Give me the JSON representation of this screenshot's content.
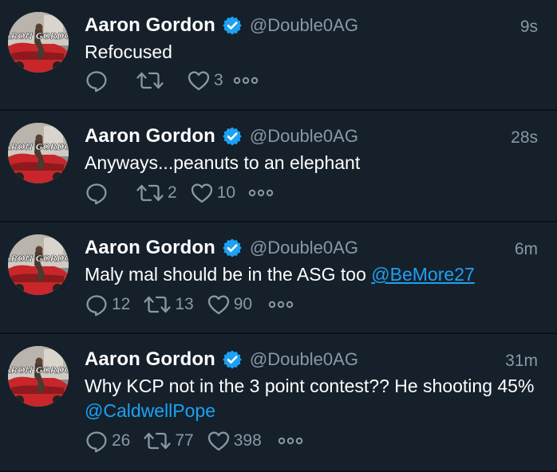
{
  "colors": {
    "background": "#15202b",
    "separator": "#0b1016",
    "text": "#ffffff",
    "muted": "#8899a6",
    "link": "#1da1f2",
    "verified": "#1da1f2"
  },
  "tweets": [
    {
      "name": "Aaron Gordon",
      "handle": "@Double0AG",
      "time": "9s",
      "text": "Refocused",
      "mention": "",
      "reply_count": "",
      "retweet_count": "",
      "like_count": "3"
    },
    {
      "name": "Aaron Gordon",
      "handle": "@Double0AG",
      "time": "28s",
      "text": "Anyways...peanuts to an elephant",
      "mention": "",
      "reply_count": "",
      "retweet_count": "2",
      "like_count": "10"
    },
    {
      "name": "Aaron Gordon",
      "handle": "@Double0AG",
      "time": "6m",
      "text": "Maly mal should be in the ASG too ",
      "mention": "@BeMore27",
      "reply_count": "12",
      "retweet_count": "13",
      "like_count": "90"
    },
    {
      "name": "Aaron Gordon",
      "handle": "@Double0AG",
      "time": "31m",
      "text": "Why KCP not in the 3 point contest?? He shooting 45% ",
      "mention": "@CaldwellPope",
      "reply_count": "26",
      "retweet_count": "77",
      "like_count": "398"
    }
  ],
  "icons": {
    "reply": "reply-icon",
    "retweet": "retweet-icon",
    "like": "heart-icon",
    "more": "more-icon",
    "verified": "verified-badge-icon"
  }
}
